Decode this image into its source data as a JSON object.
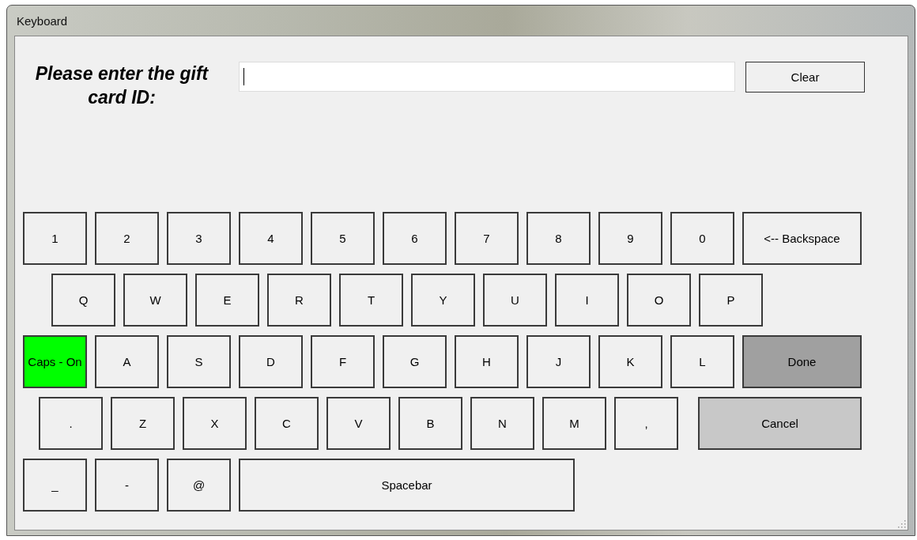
{
  "window": {
    "title": "Keyboard"
  },
  "prompt": "Please enter the gift card ID:",
  "input": {
    "focused": true
  },
  "clear_button": "Clear",
  "rows": [
    [
      {
        "label": "1",
        "kind": "char"
      },
      {
        "label": "2",
        "kind": "char"
      },
      {
        "label": "3",
        "kind": "char"
      },
      {
        "label": "4",
        "kind": "char"
      },
      {
        "label": "5",
        "kind": "char"
      },
      {
        "label": "6",
        "kind": "char"
      },
      {
        "label": "7",
        "kind": "char"
      },
      {
        "label": "8",
        "kind": "char"
      },
      {
        "label": "9",
        "kind": "char"
      },
      {
        "label": "0",
        "kind": "char"
      },
      {
        "label": "<-- Backspace",
        "kind": "wide"
      }
    ],
    [
      {
        "label": "Q",
        "kind": "char"
      },
      {
        "label": "W",
        "kind": "char"
      },
      {
        "label": "E",
        "kind": "char"
      },
      {
        "label": "R",
        "kind": "char"
      },
      {
        "label": "T",
        "kind": "char"
      },
      {
        "label": "Y",
        "kind": "char"
      },
      {
        "label": "U",
        "kind": "char"
      },
      {
        "label": "I",
        "kind": "char"
      },
      {
        "label": "O",
        "kind": "char"
      },
      {
        "label": "P",
        "kind": "char"
      }
    ],
    [
      {
        "label": "Caps - On",
        "kind": "toggle",
        "on": true
      },
      {
        "label": "A",
        "kind": "char"
      },
      {
        "label": "S",
        "kind": "char"
      },
      {
        "label": "D",
        "kind": "char"
      },
      {
        "label": "F",
        "kind": "char"
      },
      {
        "label": "G",
        "kind": "char"
      },
      {
        "label": "H",
        "kind": "char"
      },
      {
        "label": "J",
        "kind": "char"
      },
      {
        "label": "K",
        "kind": "char"
      },
      {
        "label": "L",
        "kind": "char"
      },
      {
        "label": "Done",
        "kind": "done"
      }
    ],
    [
      {
        "label": ".",
        "kind": "char"
      },
      {
        "label": "Z",
        "kind": "char"
      },
      {
        "label": "X",
        "kind": "char"
      },
      {
        "label": "C",
        "kind": "char"
      },
      {
        "label": "V",
        "kind": "char"
      },
      {
        "label": "B",
        "kind": "char"
      },
      {
        "label": "N",
        "kind": "char"
      },
      {
        "label": "M",
        "kind": "char"
      },
      {
        "label": ",",
        "kind": "char"
      },
      {
        "label": "Cancel",
        "kind": "cancel"
      }
    ],
    [
      {
        "label": "_",
        "kind": "char"
      },
      {
        "label": "-",
        "kind": "char"
      },
      {
        "label": "@",
        "kind": "char"
      },
      {
        "label": "Spacebar",
        "kind": "space"
      }
    ]
  ]
}
